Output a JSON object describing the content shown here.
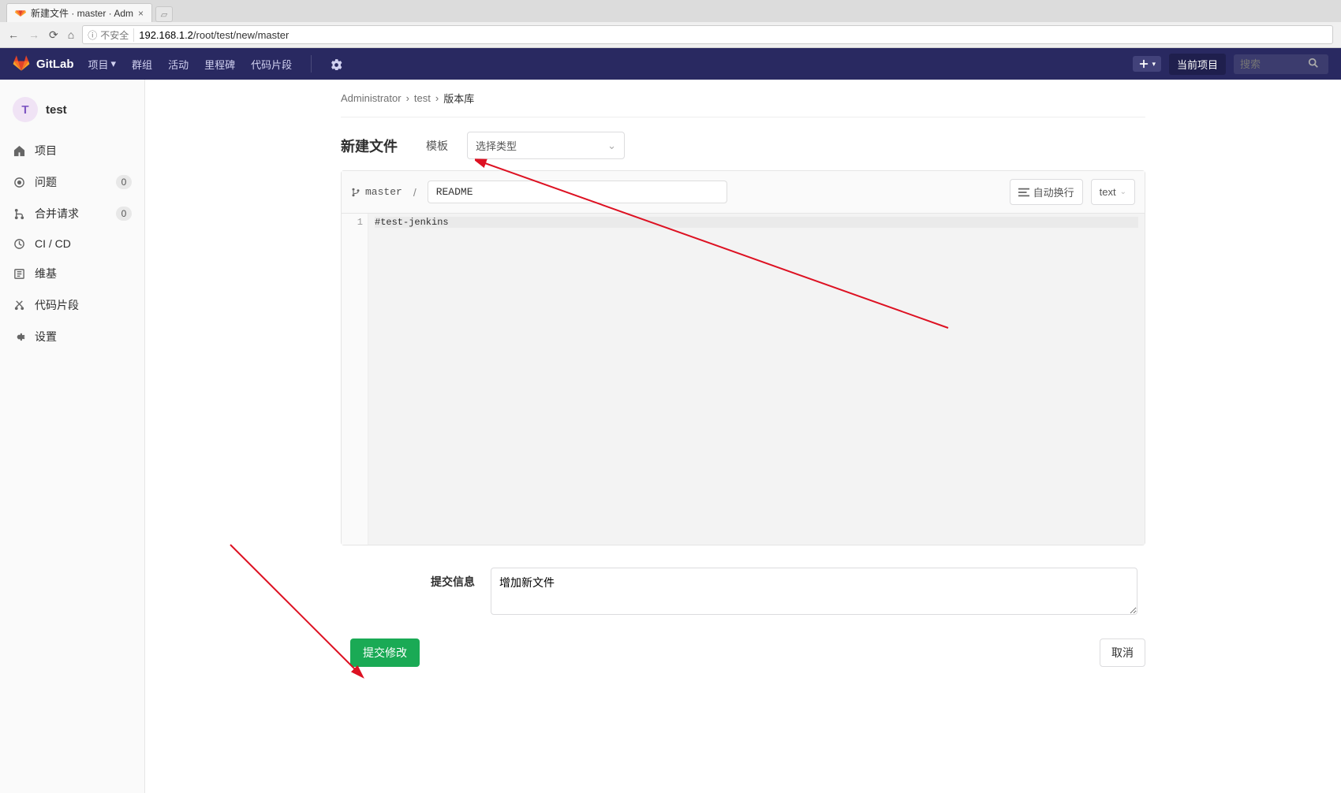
{
  "browser": {
    "tab_title": "新建文件 · master · Adm",
    "url_warning": "不安全",
    "url_host": "192.168.1.2",
    "url_path": "/root/test/new/master"
  },
  "topnav": {
    "brand": "GitLab",
    "items": [
      "项目",
      "群组",
      "活动",
      "里程碑",
      "代码片段"
    ],
    "plus_label": "+",
    "current_project": "当前项目",
    "search_placeholder": "搜索"
  },
  "sidebar": {
    "avatar_letter": "T",
    "project_name": "test",
    "items": [
      {
        "icon": "home",
        "label": "项目",
        "badge": null
      },
      {
        "icon": "issues",
        "label": "问题",
        "badge": "0"
      },
      {
        "icon": "merge",
        "label": "合并请求",
        "badge": "0"
      },
      {
        "icon": "ci",
        "label": "CI / CD",
        "badge": null
      },
      {
        "icon": "wiki",
        "label": "维基",
        "badge": null
      },
      {
        "icon": "snippets",
        "label": "代码片段",
        "badge": null
      },
      {
        "icon": "settings",
        "label": "设置",
        "badge": null
      }
    ]
  },
  "breadcrumbs": [
    "Administrator",
    "test",
    "版本库"
  ],
  "page": {
    "title": "新建文件",
    "template_label": "模板",
    "template_placeholder": "选择类型",
    "branch": "master",
    "filename": "README",
    "wrap_label": "自动换行",
    "lang_label": "text",
    "code_line_number": "1",
    "code_content": "#test-jenkins"
  },
  "commit": {
    "label": "提交信息",
    "message": "增加新文件",
    "submit": "提交修改",
    "cancel": "取消"
  }
}
